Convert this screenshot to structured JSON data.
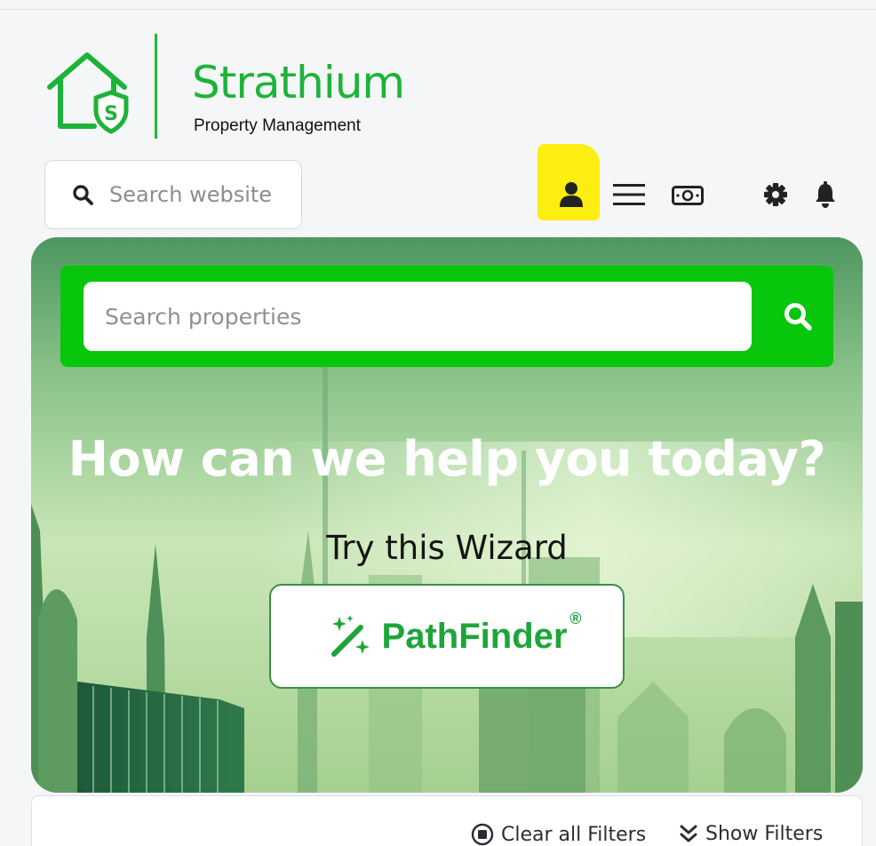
{
  "brand": {
    "name": "Strathium",
    "subtitle": "Property Management",
    "logo_letter": "S",
    "color": "#1db33a"
  },
  "site_search": {
    "placeholder": "Search website",
    "icon": "search-icon"
  },
  "toolbar": {
    "icons": [
      "user-icon",
      "menu-icon",
      "money-icon",
      "gear-icon",
      "bell-icon"
    ],
    "highlight_color": "#fcee10"
  },
  "hero": {
    "search_placeholder": "Search properties",
    "search_bar_color": "#08c60c",
    "title": "How can we help you today?",
    "subtitle": "Try this Wizard",
    "wizard_button": {
      "label": "PathFinder",
      "mark": "®",
      "icon": "magic-wand-icon"
    }
  },
  "filters": {
    "clear_label": "Clear all Filters",
    "show_label": "Show Filters"
  }
}
